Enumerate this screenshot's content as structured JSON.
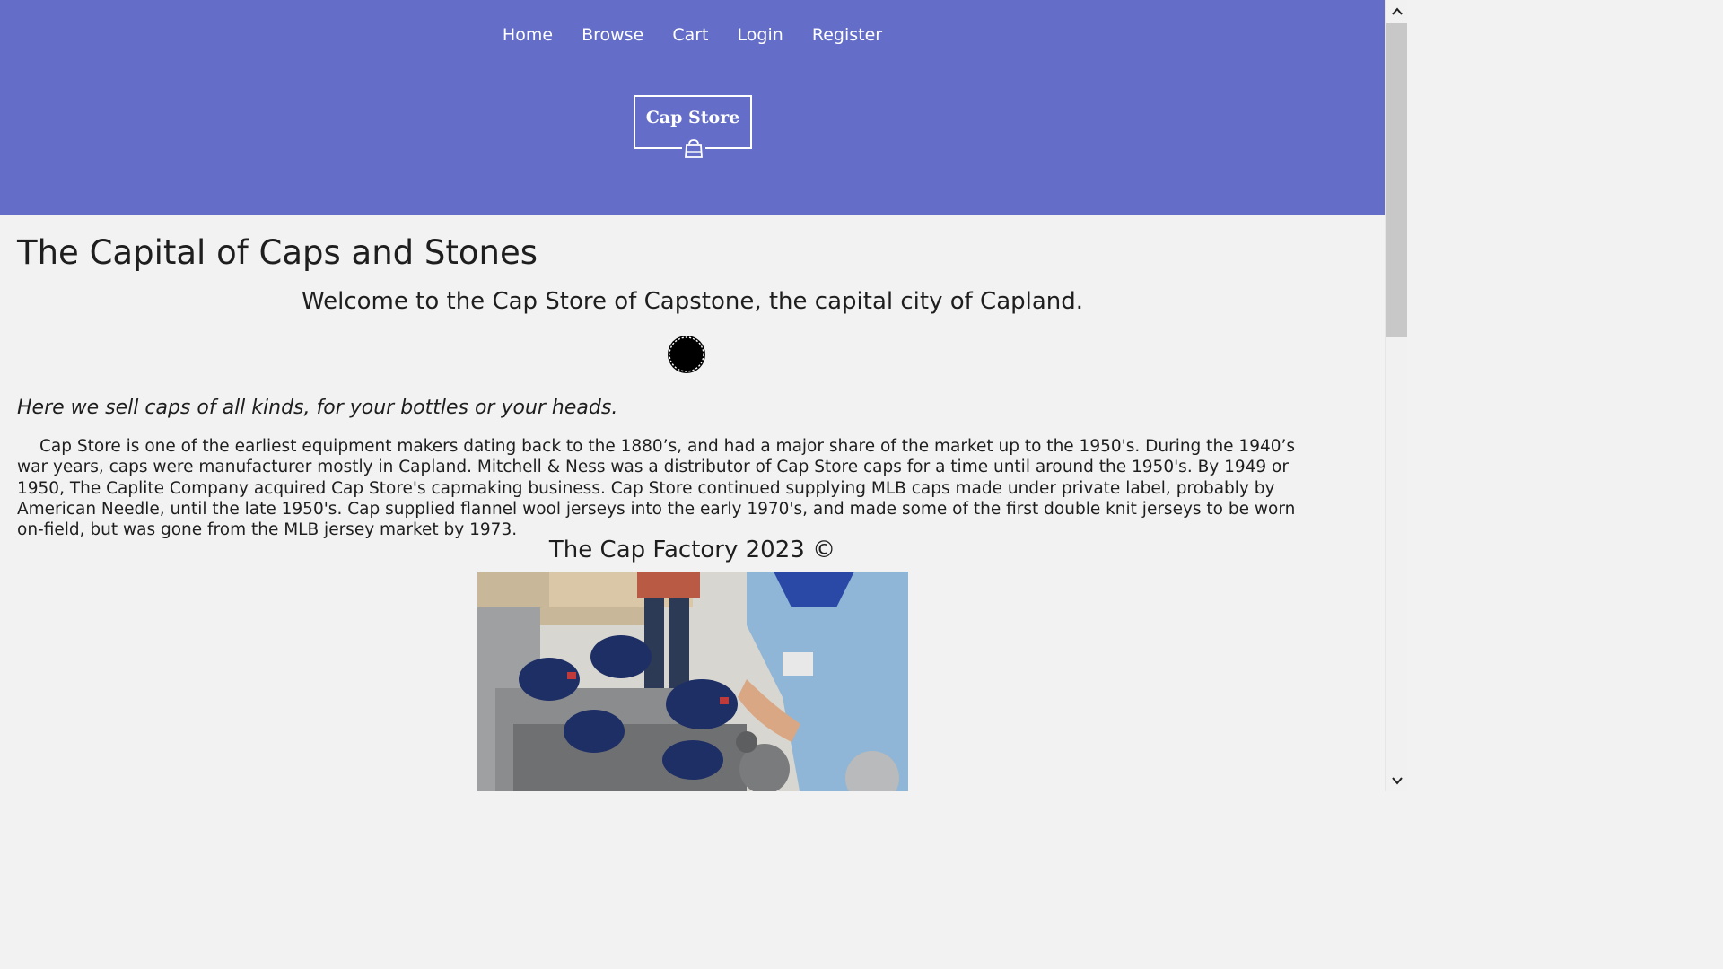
{
  "nav": {
    "items": [
      {
        "label": "Home"
      },
      {
        "label": "Browse"
      },
      {
        "label": "Cart"
      },
      {
        "label": "Login"
      },
      {
        "label": "Register"
      }
    ]
  },
  "logo": {
    "text": "Cap Store",
    "icon": "shopping-bag-icon"
  },
  "main": {
    "title": "The Capital of Caps and Stones",
    "welcome": "Welcome to the Cap Store of Capstone, the capital city of Capland.",
    "cap_graphic": "bottle-cap-icon",
    "tagline": "Here we sell caps of all kinds, for your bottles or your heads.",
    "body": "Cap Store is one of the earliest equipment makers dating back to the 1880’s, and had a major share of the market up to the 1950's. During the 1940’s war years, caps were manufacturer mostly in Capland. Mitchell & Ness was a distributor of Cap Store caps for a time until around the 1950's. By 1949 or 1950, The Caplite Company acquired Cap Store's capmaking business. Cap Store continued supplying MLB caps made under private label, probably by American Needle, until the late 1950's. Cap supplied flannel wool jerseys into the early 1970's, and made some of the first double knit jerseys to be worn on-field, but was gone from the MLB jersey market by 1973.",
    "footer": "The Cap Factory 2023 ©",
    "photo": "cap-factory-photo"
  },
  "colors": {
    "header": "#646ec8",
    "background": "#f2f2f2",
    "text": "#1e1e1e"
  },
  "scrollbar": {
    "up_icon": "chevron-up-icon",
    "down_icon": "chevron-down-icon"
  }
}
